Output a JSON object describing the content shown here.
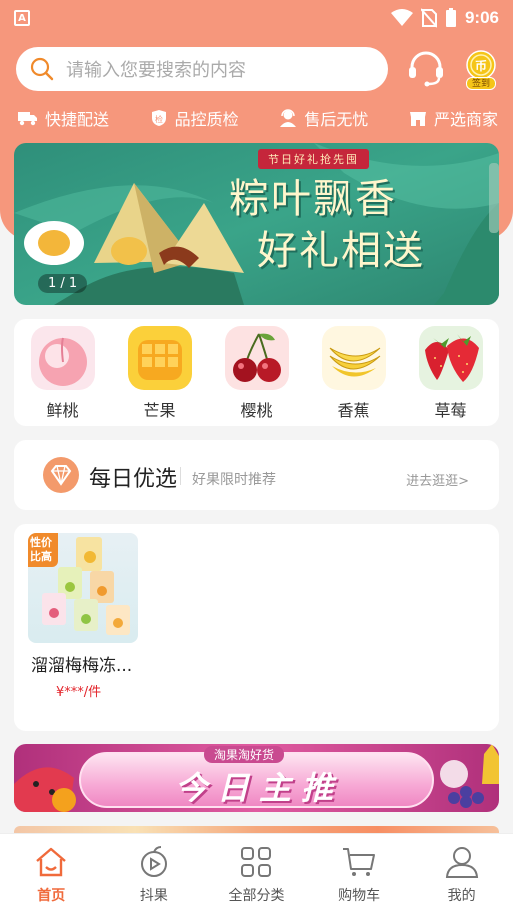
{
  "status_bar": {
    "time": "9:06"
  },
  "search": {
    "placeholder": "请输入您要搜索的内容",
    "checkin_label": "签到"
  },
  "features": [
    {
      "label": "快捷配送",
      "icon": "truck-icon"
    },
    {
      "label": "品控质检",
      "icon": "shield-check-icon"
    },
    {
      "label": "售后无忧",
      "icon": "service-person-icon"
    },
    {
      "label": "严选商家",
      "icon": "store-icon"
    }
  ],
  "banner": {
    "tag": "节日好礼抢先囤",
    "title_line1": "粽叶飘香",
    "title_line2": "好礼相送",
    "pager": "1 / 1"
  },
  "categories": [
    {
      "label": "鲜桃",
      "icon": "peach-icon"
    },
    {
      "label": "芒果",
      "icon": "mango-icon"
    },
    {
      "label": "樱桃",
      "icon": "cherry-icon"
    },
    {
      "label": "香蕉",
      "icon": "banana-icon"
    },
    {
      "label": "草莓",
      "icon": "strawberry-icon"
    }
  ],
  "daily": {
    "title": "每日优选",
    "subtitle": "好果限时推荐",
    "more": "进去逛逛>"
  },
  "products": [
    {
      "badge": "性价比高",
      "name": "溜溜梅梅冻...",
      "price": "¥***/件"
    }
  ],
  "today_banner": {
    "top_label": "淘果淘好货",
    "title": "今日主推"
  },
  "bottom_nav": [
    {
      "label": "首页",
      "icon": "home-icon",
      "active": true
    },
    {
      "label": "抖果",
      "icon": "fruit-play-icon",
      "active": false
    },
    {
      "label": "全部分类",
      "icon": "grid-icon",
      "active": false
    },
    {
      "label": "购物车",
      "icon": "cart-icon",
      "active": false
    },
    {
      "label": "我的",
      "icon": "user-icon",
      "active": false
    }
  ],
  "colors": {
    "brand": "#f6977c",
    "active": "#f06a3b",
    "price": "#e3242b"
  }
}
